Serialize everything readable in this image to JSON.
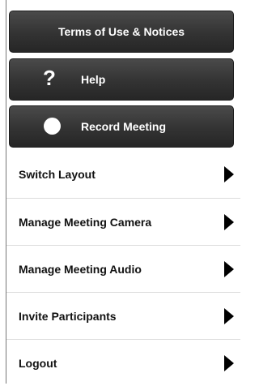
{
  "top_buttons": {
    "terms": {
      "label": "Terms of Use & Notices"
    },
    "help": {
      "icon": "question-mark-icon",
      "label": "Help"
    },
    "record": {
      "icon": "record-dot-icon",
      "label": "Record Meeting"
    }
  },
  "menu": [
    {
      "label": "Switch Layout",
      "icon": "chevron-right-icon"
    },
    {
      "label": "Manage Meeting Camera",
      "icon": "chevron-right-icon"
    },
    {
      "label": "Manage Meeting Audio",
      "icon": "chevron-right-icon"
    },
    {
      "label": "Invite Participants",
      "icon": "chevron-right-icon"
    },
    {
      "label": "Logout",
      "icon": "chevron-right-icon"
    }
  ],
  "colors": {
    "button_dark": "#333333",
    "button_text": "#ffffff",
    "row_text": "#111111",
    "divider": "#dcdcdc"
  },
  "help_glyph": "?"
}
